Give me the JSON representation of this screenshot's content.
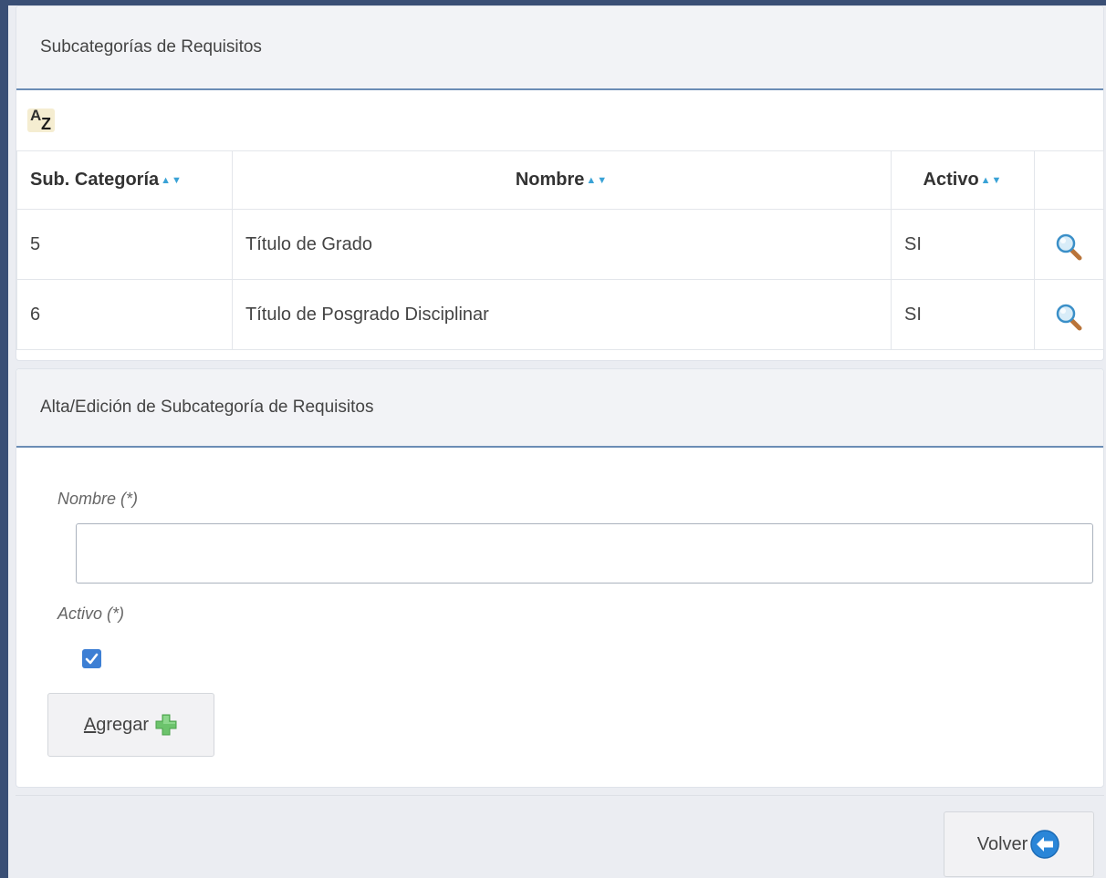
{
  "list": {
    "title": "Subcategorías de Requisitos",
    "sort_icon": "az-sort-icon",
    "columns": [
      "Sub. Categoría",
      "Nombre",
      "Activo"
    ],
    "rows": [
      {
        "id": "5",
        "nombre": "Título de Grado",
        "activo": "SI"
      },
      {
        "id": "6",
        "nombre": "Título de Posgrado Disciplinar",
        "activo": "SI"
      }
    ]
  },
  "form": {
    "title": "Alta/Edición de Subcategoría de Requisitos",
    "nombre_label": "Nombre (*)",
    "nombre_value": "",
    "activo_label": "Activo (*)",
    "activo_checked": true,
    "add_label_first": "A",
    "add_label_rest": "gregar"
  },
  "footer": {
    "back_label": "Volver"
  },
  "colors": {
    "accent": "#3d7fd4",
    "frame": "#3a4f75",
    "header_border": "#6b8cb5"
  }
}
